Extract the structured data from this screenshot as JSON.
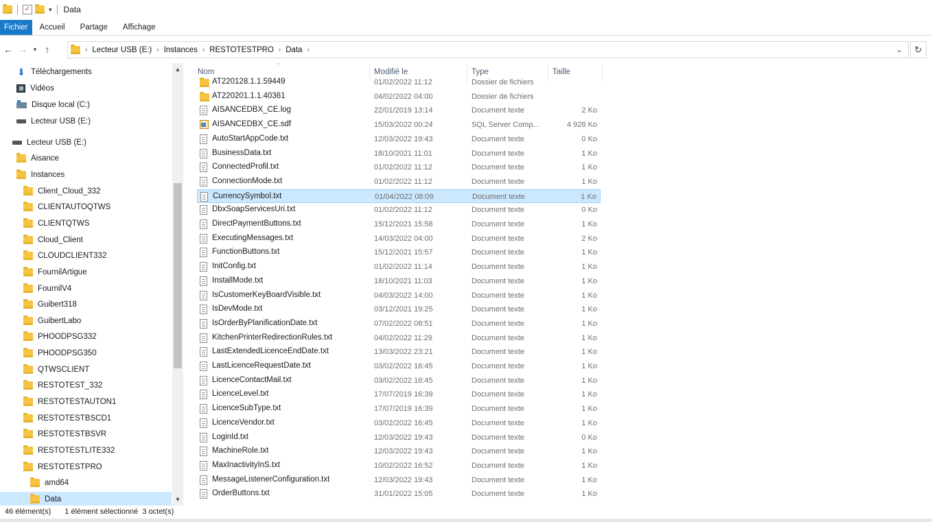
{
  "window": {
    "title": "Data"
  },
  "ribbon": {
    "tabs": [
      "Fichier",
      "Accueil",
      "Partage",
      "Affichage"
    ]
  },
  "address": {
    "crumbs": [
      "Lecteur USB (E:)",
      "Instances",
      "RESTOTESTPRO",
      "Data"
    ]
  },
  "nav": {
    "items": [
      {
        "label": "Téléchargements",
        "icon": "download-icon",
        "indent": 1
      },
      {
        "label": "Vidéos",
        "icon": "video-icon",
        "indent": 1
      },
      {
        "label": "Disque local (C:)",
        "icon": "local-disk-icon",
        "indent": 1
      },
      {
        "label": "Lecteur USB (E:)",
        "icon": "usb-drive-icon",
        "indent": 1
      },
      {
        "label": "Lecteur USB (E:)",
        "icon": "usb-drive-icon",
        "indent": 0
      },
      {
        "label": "Aisance",
        "icon": "folder-icon",
        "indent": 1
      },
      {
        "label": "Instances",
        "icon": "folder-icon",
        "indent": 1
      },
      {
        "label": "Client_Cloud_332",
        "icon": "folder-icon",
        "indent": 2
      },
      {
        "label": "CLIENTAUTOQTWS",
        "icon": "folder-icon",
        "indent": 2
      },
      {
        "label": "CLIENTQTWS",
        "icon": "folder-icon",
        "indent": 2
      },
      {
        "label": "Cloud_Client",
        "icon": "folder-icon",
        "indent": 2
      },
      {
        "label": "CLOUDCLIENT332",
        "icon": "folder-icon",
        "indent": 2
      },
      {
        "label": "FournilArtigue",
        "icon": "folder-icon",
        "indent": 2
      },
      {
        "label": "FournilV4",
        "icon": "folder-icon",
        "indent": 2
      },
      {
        "label": "Guibert318",
        "icon": "folder-icon",
        "indent": 2
      },
      {
        "label": "GuibertLabo",
        "icon": "folder-icon",
        "indent": 2
      },
      {
        "label": "PHOODPSG332",
        "icon": "folder-icon",
        "indent": 2
      },
      {
        "label": "PHOODPSG350",
        "icon": "folder-icon",
        "indent": 2
      },
      {
        "label": "QTWSCLIENT",
        "icon": "folder-icon",
        "indent": 2
      },
      {
        "label": "RESTOTEST_332",
        "icon": "folder-icon",
        "indent": 2
      },
      {
        "label": "RESTOTESTAUTON1",
        "icon": "folder-icon",
        "indent": 2
      },
      {
        "label": "RESTOTESTBSCD1",
        "icon": "folder-icon",
        "indent": 2
      },
      {
        "label": "RESTOTESTBSVR",
        "icon": "folder-icon",
        "indent": 2
      },
      {
        "label": "RESTOTESTLITE332",
        "icon": "folder-icon",
        "indent": 2
      },
      {
        "label": "RESTOTESTPRO",
        "icon": "folder-icon",
        "indent": 2
      },
      {
        "label": "amd64",
        "icon": "folder-icon",
        "indent": 3
      },
      {
        "label": "Data",
        "icon": "folder-icon",
        "indent": 3,
        "selected": true
      }
    ]
  },
  "columns": {
    "name": "Nom",
    "modified": "Modifié le",
    "type": "Type",
    "size": "Taille"
  },
  "files": [
    {
      "name": "AT220128.1.1.59449",
      "date": "01/02/2022 11:12",
      "type": "Dossier de fichiers",
      "size": "",
      "icon": "folder-icon"
    },
    {
      "name": "AT220201.1.1.40361",
      "date": "04/02/2022 04:00",
      "type": "Dossier de fichiers",
      "size": "",
      "icon": "folder-icon"
    },
    {
      "name": "AISANCEDBX_CE.log",
      "date": "22/01/2019 13:14",
      "type": "Document texte",
      "size": "2 Ko",
      "icon": "text-file-icon"
    },
    {
      "name": "AISANCEDBX_CE.sdf",
      "date": "15/03/2022 00:24",
      "type": "SQL Server Comp...",
      "size": "4 928 Ko",
      "icon": "sql-file-icon"
    },
    {
      "name": "AutoStartAppCode.txt",
      "date": "12/03/2022 19:43",
      "type": "Document texte",
      "size": "0 Ko",
      "icon": "text-file-icon"
    },
    {
      "name": "BusinessData.txt",
      "date": "18/10/2021 11:01",
      "type": "Document texte",
      "size": "1 Ko",
      "icon": "text-file-icon"
    },
    {
      "name": "ConnectedProfil.txt",
      "date": "01/02/2022 11:12",
      "type": "Document texte",
      "size": "1 Ko",
      "icon": "text-file-icon"
    },
    {
      "name": "ConnectionMode.txt",
      "date": "01/02/2022 11:12",
      "type": "Document texte",
      "size": "1 Ko",
      "icon": "text-file-icon"
    },
    {
      "name": "CurrencySymbol.txt",
      "date": "01/04/2022 08:09",
      "type": "Document texte",
      "size": "1 Ko",
      "icon": "text-file-icon",
      "selected": true
    },
    {
      "name": "DbxSoapServicesUri.txt",
      "date": "01/02/2022 11:12",
      "type": "Document texte",
      "size": "0 Ko",
      "icon": "text-file-icon"
    },
    {
      "name": "DirectPaymentButtons.txt",
      "date": "15/12/2021 15:58",
      "type": "Document texte",
      "size": "1 Ko",
      "icon": "text-file-icon"
    },
    {
      "name": "ExecutingMessages.txt",
      "date": "14/03/2022 04:00",
      "type": "Document texte",
      "size": "2 Ko",
      "icon": "text-file-icon"
    },
    {
      "name": "FunctionButtons.txt",
      "date": "15/12/2021 15:57",
      "type": "Document texte",
      "size": "1 Ko",
      "icon": "text-file-icon"
    },
    {
      "name": "InitConfig.txt",
      "date": "01/02/2022 11:14",
      "type": "Document texte",
      "size": "1 Ko",
      "icon": "text-file-icon"
    },
    {
      "name": "InstallMode.txt",
      "date": "18/10/2021 11:03",
      "type": "Document texte",
      "size": "1 Ko",
      "icon": "text-file-icon"
    },
    {
      "name": "IsCustomerKeyBoardVisible.txt",
      "date": "04/03/2022 14:00",
      "type": "Document texte",
      "size": "1 Ko",
      "icon": "text-file-icon"
    },
    {
      "name": "IsDevMode.txt",
      "date": "03/12/2021 19:25",
      "type": "Document texte",
      "size": "1 Ko",
      "icon": "text-file-icon"
    },
    {
      "name": "IsOrderByPlanificationDate.txt",
      "date": "07/02/2022 08:51",
      "type": "Document texte",
      "size": "1 Ko",
      "icon": "text-file-icon"
    },
    {
      "name": "KitchenPrinterRedirectionRules.txt",
      "date": "04/02/2022 11:29",
      "type": "Document texte",
      "size": "1 Ko",
      "icon": "text-file-icon"
    },
    {
      "name": "LastExtendedLicenceEndDate.txt",
      "date": "13/03/2022 23:21",
      "type": "Document texte",
      "size": "1 Ko",
      "icon": "text-file-icon"
    },
    {
      "name": "LastLicenceRequestDate.txt",
      "date": "03/02/2022 16:45",
      "type": "Document texte",
      "size": "1 Ko",
      "icon": "text-file-icon"
    },
    {
      "name": "LicenceContactMail.txt",
      "date": "03/02/2022 16:45",
      "type": "Document texte",
      "size": "1 Ko",
      "icon": "text-file-icon"
    },
    {
      "name": "LicenceLevel.txt",
      "date": "17/07/2019 16:39",
      "type": "Document texte",
      "size": "1 Ko",
      "icon": "text-file-icon"
    },
    {
      "name": "LicenceSubType.txt",
      "date": "17/07/2019 16:39",
      "type": "Document texte",
      "size": "1 Ko",
      "icon": "text-file-icon"
    },
    {
      "name": "LicenceVendor.txt",
      "date": "03/02/2022 16:45",
      "type": "Document texte",
      "size": "1 Ko",
      "icon": "text-file-icon"
    },
    {
      "name": "LoginId.txt",
      "date": "12/03/2022 19:43",
      "type": "Document texte",
      "size": "0 Ko",
      "icon": "text-file-icon"
    },
    {
      "name": "MachineRole.txt",
      "date": "12/03/2022 19:43",
      "type": "Document texte",
      "size": "1 Ko",
      "icon": "text-file-icon"
    },
    {
      "name": "MaxInactivityInS.txt",
      "date": "10/02/2022 16:52",
      "type": "Document texte",
      "size": "1 Ko",
      "icon": "text-file-icon"
    },
    {
      "name": "MessageListenerConfiguration.txt",
      "date": "12/03/2022 19:43",
      "type": "Document texte",
      "size": "1 Ko",
      "icon": "text-file-icon"
    },
    {
      "name": "OrderButtons.txt",
      "date": "31/01/2022 15:05",
      "type": "Document texte",
      "size": "1 Ko",
      "icon": "text-file-icon"
    }
  ],
  "status": {
    "count": "46 élément(s)",
    "selection": "1 élément sélectionné  3 octet(s)"
  }
}
